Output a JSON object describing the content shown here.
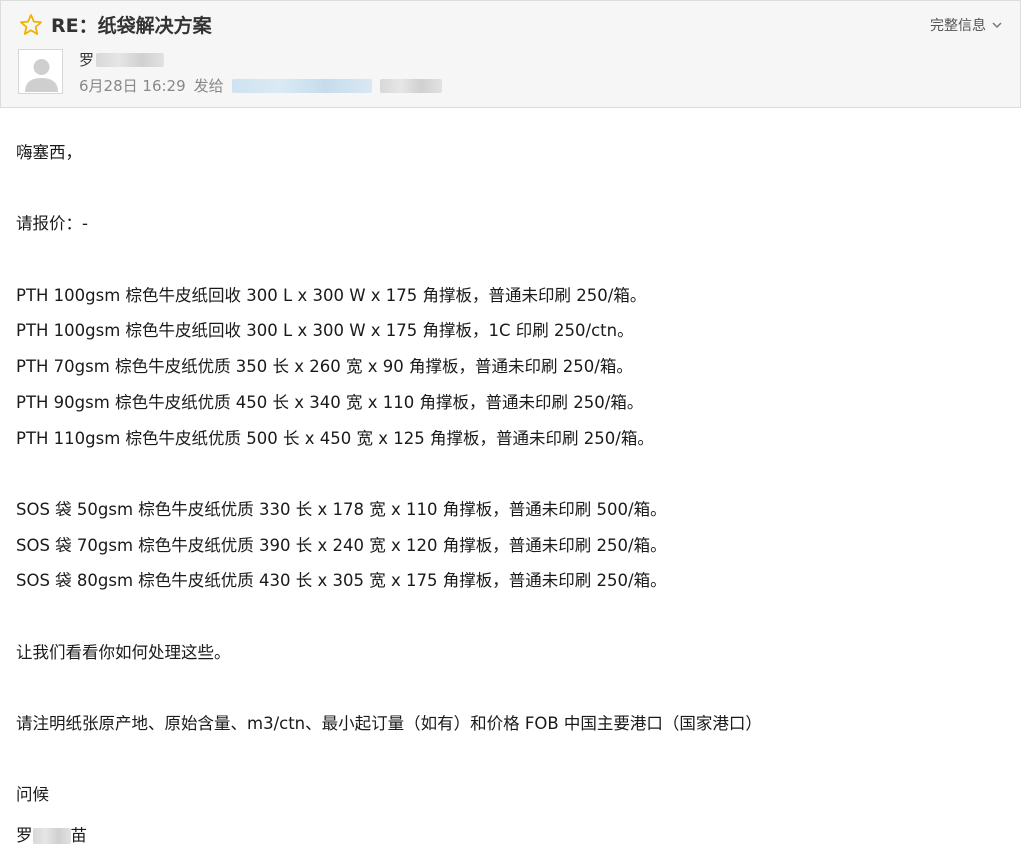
{
  "header": {
    "subject": "RE：纸袋解决方案",
    "full_info_label": "完整信息",
    "sender_name_visible": "罗",
    "date_time": "6月28日 16:29",
    "sent_to_label": "发给",
    "star_color": "#f5c518"
  },
  "body": {
    "greeting": "嗨塞西，",
    "request": "请报价：-",
    "quote_group_1": [
      "PTH 100gsm 棕色牛皮纸回收 300 L x 300 W x 175 角撑板，普通未印刷 250/箱。",
      "PTH 100gsm 棕色牛皮纸回收 300 L x 300 W x 175 角撑板，1C 印刷 250/ctn。",
      "PTH 70gsm 棕色牛皮纸优质 350 长 x 260 宽 x 90 角撑板，普通未印刷 250/箱。",
      "PTH 90gsm 棕色牛皮纸优质 450 长 x 340 宽 x 110 角撑板，普通未印刷 250/箱。",
      "PTH 110gsm 棕色牛皮纸优质 500 长 x 450 宽 x 125 角撑板，普通未印刷 250/箱。"
    ],
    "quote_group_2": [
      "SOS 袋 50gsm 棕色牛皮纸优质 330 长 x 178 宽 x 110 角撑板，普通未印刷 500/箱。",
      "SOS 袋 70gsm 棕色牛皮纸优质 390 长 x 240 宽 x 120 角撑板，普通未印刷 250/箱。",
      "SOS 袋 80gsm 棕色牛皮纸优质 430 长 x 305 宽 x 175 角撑板，普通未印刷 250/箱。"
    ],
    "closing_line": "让我们看看你如何处理这些。",
    "note": "请注明纸张原产地、原始含量、m3/ctn、最小起订量（如有）和价格 FOB 中国主要港口（国家港口）",
    "regards": "问候",
    "signature_visible_start": "罗",
    "signature_visible_end": "苗"
  }
}
